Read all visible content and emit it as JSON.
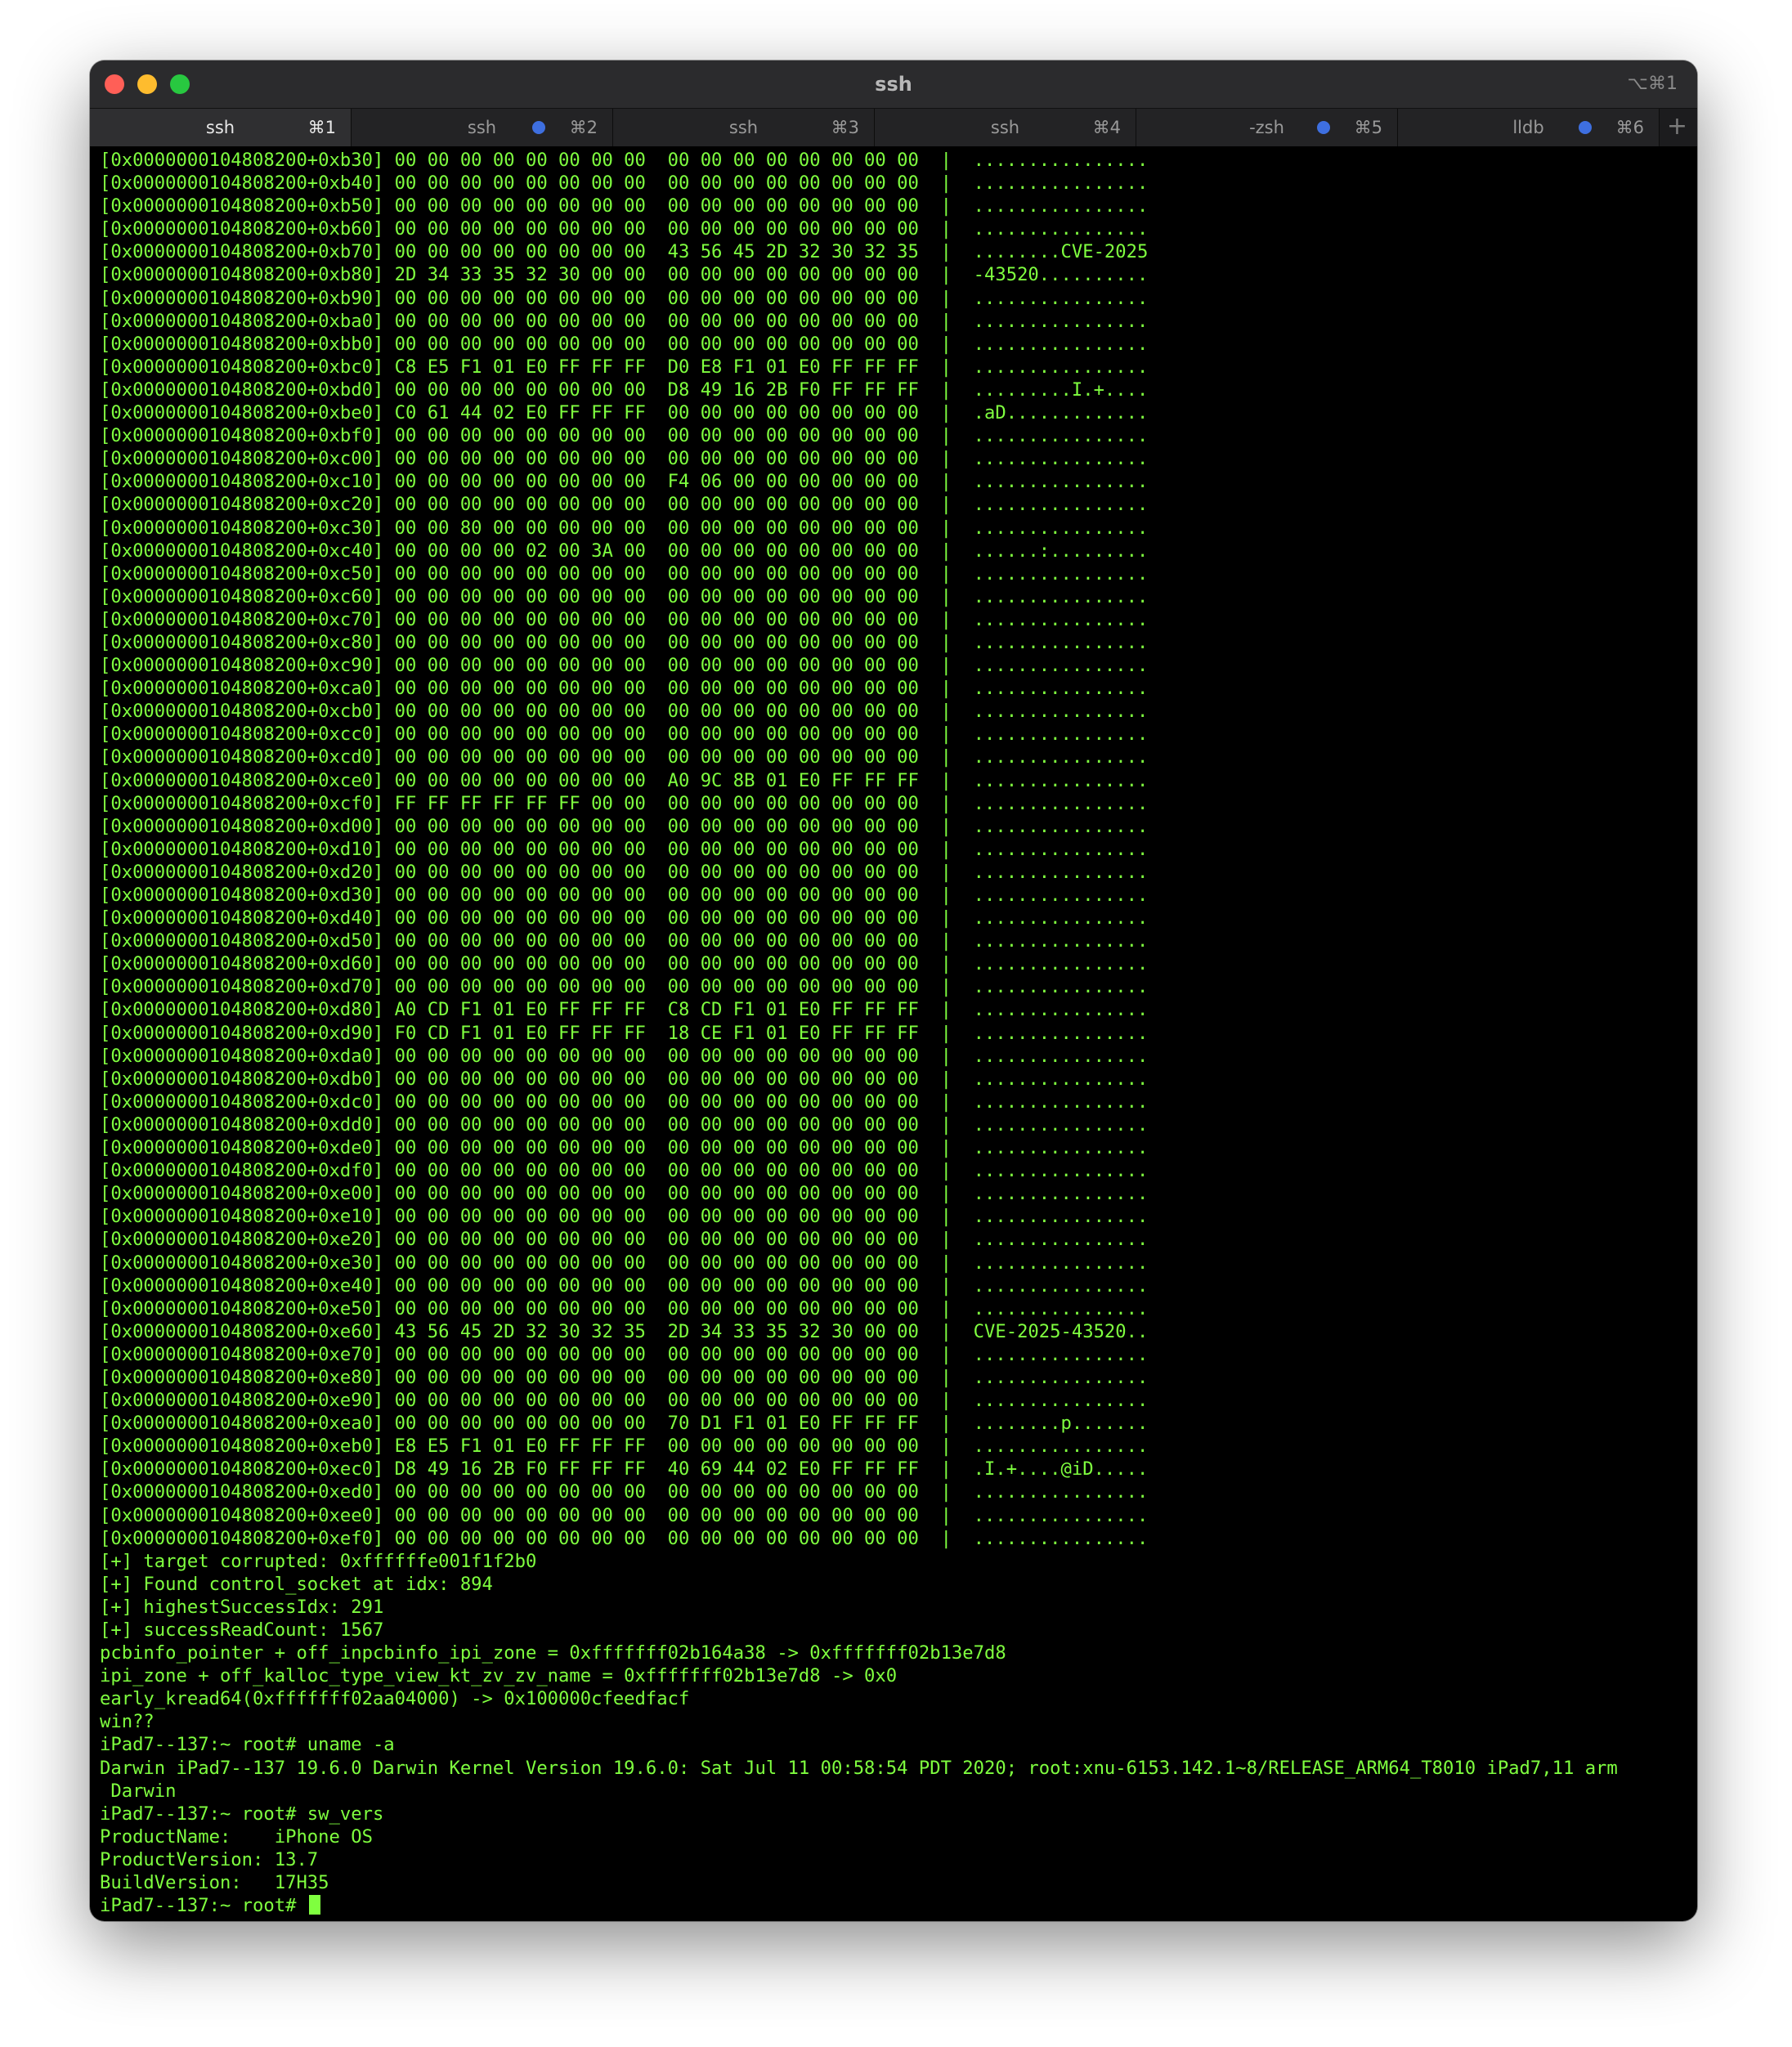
{
  "window": {
    "title": "ssh",
    "title_shortcut": "⌥⌘1"
  },
  "tabs": [
    {
      "label": "ssh",
      "shortcut": "⌘1",
      "active": true,
      "badge": false
    },
    {
      "label": "ssh",
      "shortcut": "⌘2",
      "active": false,
      "badge": true
    },
    {
      "label": "ssh",
      "shortcut": "⌘3",
      "active": false,
      "badge": false
    },
    {
      "label": "ssh",
      "shortcut": "⌘4",
      "active": false,
      "badge": false
    },
    {
      "label": "-zsh",
      "shortcut": "⌘5",
      "active": false,
      "badge": true
    },
    {
      "label": "lldb",
      "shortcut": "⌘6",
      "active": false,
      "badge": true
    }
  ],
  "new_tab_label": "+",
  "colors": {
    "terminal_text": "#7fff3f",
    "terminal_bg": "#000000",
    "tab_badge": "#3e6fe0"
  },
  "terminal": {
    "lines": [
      "[0x0000000104808200+0xb30] 00 00 00 00 00 00 00 00  00 00 00 00 00 00 00 00  |  ................",
      "[0x0000000104808200+0xb40] 00 00 00 00 00 00 00 00  00 00 00 00 00 00 00 00  |  ................",
      "[0x0000000104808200+0xb50] 00 00 00 00 00 00 00 00  00 00 00 00 00 00 00 00  |  ................",
      "[0x0000000104808200+0xb60] 00 00 00 00 00 00 00 00  00 00 00 00 00 00 00 00  |  ................",
      "[0x0000000104808200+0xb70] 00 00 00 00 00 00 00 00  43 56 45 2D 32 30 32 35  |  ........CVE-2025",
      "[0x0000000104808200+0xb80] 2D 34 33 35 32 30 00 00  00 00 00 00 00 00 00 00  |  -43520..........",
      "[0x0000000104808200+0xb90] 00 00 00 00 00 00 00 00  00 00 00 00 00 00 00 00  |  ................",
      "[0x0000000104808200+0xba0] 00 00 00 00 00 00 00 00  00 00 00 00 00 00 00 00  |  ................",
      "[0x0000000104808200+0xbb0] 00 00 00 00 00 00 00 00  00 00 00 00 00 00 00 00  |  ................",
      "[0x0000000104808200+0xbc0] C8 E5 F1 01 E0 FF FF FF  D0 E8 F1 01 E0 FF FF FF  |  ................",
      "[0x0000000104808200+0xbd0] 00 00 00 00 00 00 00 00  D8 49 16 2B F0 FF FF FF  |  .........I.+....",
      "[0x0000000104808200+0xbe0] C0 61 44 02 E0 FF FF FF  00 00 00 00 00 00 00 00  |  .aD.............",
      "[0x0000000104808200+0xbf0] 00 00 00 00 00 00 00 00  00 00 00 00 00 00 00 00  |  ................",
      "[0x0000000104808200+0xc00] 00 00 00 00 00 00 00 00  00 00 00 00 00 00 00 00  |  ................",
      "[0x0000000104808200+0xc10] 00 00 00 00 00 00 00 00  F4 06 00 00 00 00 00 00  |  ................",
      "[0x0000000104808200+0xc20] 00 00 00 00 00 00 00 00  00 00 00 00 00 00 00 00  |  ................",
      "[0x0000000104808200+0xc30] 00 00 80 00 00 00 00 00  00 00 00 00 00 00 00 00  |  ................",
      "[0x0000000104808200+0xc40] 00 00 00 00 02 00 3A 00  00 00 00 00 00 00 00 00  |  ......:.........",
      "[0x0000000104808200+0xc50] 00 00 00 00 00 00 00 00  00 00 00 00 00 00 00 00  |  ................",
      "[0x0000000104808200+0xc60] 00 00 00 00 00 00 00 00  00 00 00 00 00 00 00 00  |  ................",
      "[0x0000000104808200+0xc70] 00 00 00 00 00 00 00 00  00 00 00 00 00 00 00 00  |  ................",
      "[0x0000000104808200+0xc80] 00 00 00 00 00 00 00 00  00 00 00 00 00 00 00 00  |  ................",
      "[0x0000000104808200+0xc90] 00 00 00 00 00 00 00 00  00 00 00 00 00 00 00 00  |  ................",
      "[0x0000000104808200+0xca0] 00 00 00 00 00 00 00 00  00 00 00 00 00 00 00 00  |  ................",
      "[0x0000000104808200+0xcb0] 00 00 00 00 00 00 00 00  00 00 00 00 00 00 00 00  |  ................",
      "[0x0000000104808200+0xcc0] 00 00 00 00 00 00 00 00  00 00 00 00 00 00 00 00  |  ................",
      "[0x0000000104808200+0xcd0] 00 00 00 00 00 00 00 00  00 00 00 00 00 00 00 00  |  ................",
      "[0x0000000104808200+0xce0] 00 00 00 00 00 00 00 00  A0 9C 8B 01 E0 FF FF FF  |  ................",
      "[0x0000000104808200+0xcf0] FF FF FF FF FF FF 00 00  00 00 00 00 00 00 00 00  |  ................",
      "[0x0000000104808200+0xd00] 00 00 00 00 00 00 00 00  00 00 00 00 00 00 00 00  |  ................",
      "[0x0000000104808200+0xd10] 00 00 00 00 00 00 00 00  00 00 00 00 00 00 00 00  |  ................",
      "[0x0000000104808200+0xd20] 00 00 00 00 00 00 00 00  00 00 00 00 00 00 00 00  |  ................",
      "[0x0000000104808200+0xd30] 00 00 00 00 00 00 00 00  00 00 00 00 00 00 00 00  |  ................",
      "[0x0000000104808200+0xd40] 00 00 00 00 00 00 00 00  00 00 00 00 00 00 00 00  |  ................",
      "[0x0000000104808200+0xd50] 00 00 00 00 00 00 00 00  00 00 00 00 00 00 00 00  |  ................",
      "[0x0000000104808200+0xd60] 00 00 00 00 00 00 00 00  00 00 00 00 00 00 00 00  |  ................",
      "[0x0000000104808200+0xd70] 00 00 00 00 00 00 00 00  00 00 00 00 00 00 00 00  |  ................",
      "[0x0000000104808200+0xd80] A0 CD F1 01 E0 FF FF FF  C8 CD F1 01 E0 FF FF FF  |  ................",
      "[0x0000000104808200+0xd90] F0 CD F1 01 E0 FF FF FF  18 CE F1 01 E0 FF FF FF  |  ................",
      "[0x0000000104808200+0xda0] 00 00 00 00 00 00 00 00  00 00 00 00 00 00 00 00  |  ................",
      "[0x0000000104808200+0xdb0] 00 00 00 00 00 00 00 00  00 00 00 00 00 00 00 00  |  ................",
      "[0x0000000104808200+0xdc0] 00 00 00 00 00 00 00 00  00 00 00 00 00 00 00 00  |  ................",
      "[0x0000000104808200+0xdd0] 00 00 00 00 00 00 00 00  00 00 00 00 00 00 00 00  |  ................",
      "[0x0000000104808200+0xde0] 00 00 00 00 00 00 00 00  00 00 00 00 00 00 00 00  |  ................",
      "[0x0000000104808200+0xdf0] 00 00 00 00 00 00 00 00  00 00 00 00 00 00 00 00  |  ................",
      "[0x0000000104808200+0xe00] 00 00 00 00 00 00 00 00  00 00 00 00 00 00 00 00  |  ................",
      "[0x0000000104808200+0xe10] 00 00 00 00 00 00 00 00  00 00 00 00 00 00 00 00  |  ................",
      "[0x0000000104808200+0xe20] 00 00 00 00 00 00 00 00  00 00 00 00 00 00 00 00  |  ................",
      "[0x0000000104808200+0xe30] 00 00 00 00 00 00 00 00  00 00 00 00 00 00 00 00  |  ................",
      "[0x0000000104808200+0xe40] 00 00 00 00 00 00 00 00  00 00 00 00 00 00 00 00  |  ................",
      "[0x0000000104808200+0xe50] 00 00 00 00 00 00 00 00  00 00 00 00 00 00 00 00  |  ................",
      "[0x0000000104808200+0xe60] 43 56 45 2D 32 30 32 35  2D 34 33 35 32 30 00 00  |  CVE-2025-43520..",
      "[0x0000000104808200+0xe70] 00 00 00 00 00 00 00 00  00 00 00 00 00 00 00 00  |  ................",
      "[0x0000000104808200+0xe80] 00 00 00 00 00 00 00 00  00 00 00 00 00 00 00 00  |  ................",
      "[0x0000000104808200+0xe90] 00 00 00 00 00 00 00 00  00 00 00 00 00 00 00 00  |  ................",
      "[0x0000000104808200+0xea0] 00 00 00 00 00 00 00 00  70 D1 F1 01 E0 FF FF FF  |  ........p.......",
      "[0x0000000104808200+0xeb0] E8 E5 F1 01 E0 FF FF FF  00 00 00 00 00 00 00 00  |  ................",
      "[0x0000000104808200+0xec0] D8 49 16 2B F0 FF FF FF  40 69 44 02 E0 FF FF FF  |  .I.+....@iD.....",
      "[0x0000000104808200+0xed0] 00 00 00 00 00 00 00 00  00 00 00 00 00 00 00 00  |  ................",
      "[0x0000000104808200+0xee0] 00 00 00 00 00 00 00 00  00 00 00 00 00 00 00 00  |  ................",
      "[0x0000000104808200+0xef0] 00 00 00 00 00 00 00 00  00 00 00 00 00 00 00 00  |  ................",
      "[+] target corrupted: 0xffffffe001f1f2b0",
      "[+] Found control_socket at idx: 894",
      "[+] highestSuccessIdx: 291",
      "[+] successReadCount: 1567",
      "pcbinfo_pointer + off_inpcbinfo_ipi_zone = 0xfffffff02b164a38 -> 0xfffffff02b13e7d8",
      "ipi_zone + off_kalloc_type_view_kt_zv_zv_name = 0xfffffff02b13e7d8 -> 0x0",
      "early_kread64(0xfffffff02aa04000) -> 0x100000cfeedfacf",
      "win??",
      "iPad7--137:~ root# uname -a",
      "Darwin iPad7--137 19.6.0 Darwin Kernel Version 19.6.0: Sat Jul 11 00:58:54 PDT 2020; root:xnu-6153.142.1~8/RELEASE_ARM64_T8010 iPad7,11 arm",
      " Darwin",
      "iPad7--137:~ root# sw_vers",
      "ProductName:    iPhone OS",
      "ProductVersion: 13.7",
      "BuildVersion:   17H35"
    ],
    "prompt": "iPad7--137:~ root# "
  }
}
